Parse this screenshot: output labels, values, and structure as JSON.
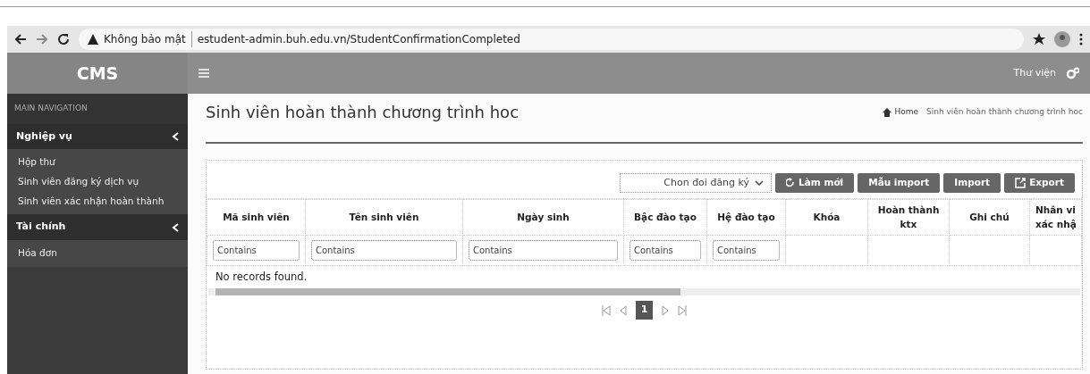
{
  "browser": {
    "security": "Không bảo mật",
    "url": "estudent-admin.buh.edu.vn/StudentConfirmationCompleted"
  },
  "header": {
    "logo": "CMS",
    "right_link": "Thư viện"
  },
  "sidebar": {
    "section": "MAIN NAVIGATION",
    "groups": [
      {
        "label": "Nghiệp vụ",
        "expanded": true,
        "children": [
          {
            "label": "Hộp thư"
          },
          {
            "label": "Sinh viên đăng ký dịch vụ"
          },
          {
            "label": "Sinh viên xác nhận hoàn thành"
          }
        ]
      },
      {
        "label": "Tài chính",
        "expanded": true,
        "children": [
          {
            "label": "Hóa đơn"
          }
        ]
      }
    ]
  },
  "page": {
    "title": "Sinh viên hoàn thành chương trình hoc",
    "breadcrumb": [
      "Home",
      "Sinh viên hoàn thành chương trình hoc"
    ]
  },
  "toolbar": {
    "select": "Chon đoi đăng ký",
    "buttons": [
      {
        "label": "Làm mới",
        "kind": "refresh"
      },
      {
        "label": "Mẫu import",
        "kind": "plain"
      },
      {
        "label": "Import",
        "kind": "plain"
      },
      {
        "label": "Export",
        "kind": "export"
      }
    ]
  },
  "table": {
    "columns": [
      {
        "label": "Mã sinh viên",
        "placeholder": "Contains"
      },
      {
        "label": "Tên sinh viên",
        "placeholder": "Contains"
      },
      {
        "label": "Ngày sinh",
        "placeholder": "Contains"
      },
      {
        "label": "Bậc đào tạo",
        "placeholder": "Contains"
      },
      {
        "label": "Hệ đào tạo",
        "placeholder": "Contains"
      },
      {
        "label": "Khóa"
      },
      {
        "label": "Hoàn thành ktx"
      },
      {
        "label": "Ghi chú"
      },
      {
        "label": "Nhân vi xác nhậ"
      }
    ],
    "empty_message": "No records found."
  },
  "pager": {
    "pages": [
      {
        "label": "1",
        "selected": true
      }
    ]
  }
}
